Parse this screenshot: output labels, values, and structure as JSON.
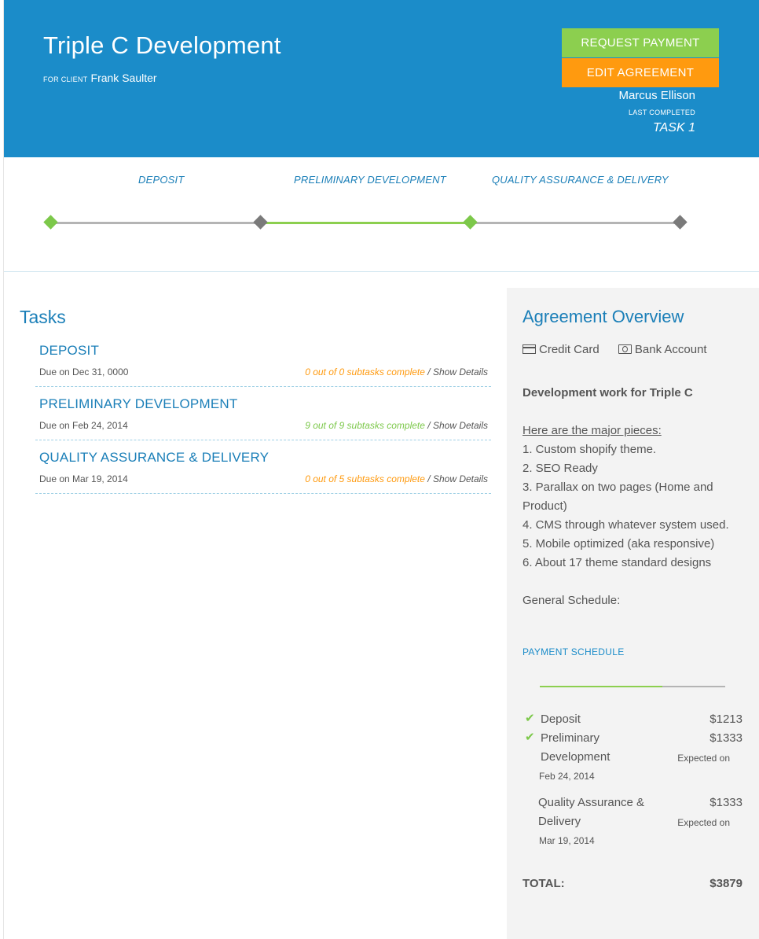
{
  "header": {
    "project_title": "Triple C Development",
    "client_label": "FOR CLIENT",
    "client_name": "Frank Saulter",
    "request_payment_label": "REQUEST PAYMENT",
    "edit_agreement_label": "EDIT AGREEMENT",
    "owner_name": "Marcus Ellison",
    "last_completed_label": "LAST COMPLETED",
    "last_completed_task": "TASK 1"
  },
  "progress": {
    "phases": [
      "DEPOSIT",
      "PRELIMINARY DEVELOPMENT",
      "QUALITY ASSURANCE & DELIVERY"
    ],
    "milestone_states": [
      "complete",
      "incomplete",
      "complete",
      "incomplete"
    ],
    "colors": {
      "complete": "#7cc84a",
      "incomplete": "#7a7a7a",
      "track_active": "#8ccf4f",
      "track_inactive": "#b4b4b4"
    }
  },
  "tasks": {
    "title": "Tasks",
    "items": [
      {
        "name": "DEPOSIT",
        "due": "Due on Dec 31, 0000",
        "subtasks": "0 out of 0 subtasks complete",
        "status_color": "orange",
        "separator": " / ",
        "details_label": "Show Details"
      },
      {
        "name": "PRELIMINARY DEVELOPMENT",
        "due": "Due on Feb 24, 2014",
        "subtasks": "9 out of 9 subtasks complete",
        "status_color": "green",
        "separator": " / ",
        "details_label": "Show Details"
      },
      {
        "name": "QUALITY ASSURANCE & DELIVERY",
        "due": "Due on Mar 19, 2014",
        "subtasks": "0 out of 5 subtasks complete",
        "status_color": "orange",
        "separator": " / ",
        "details_label": "Show Details"
      }
    ]
  },
  "overview": {
    "title": "Agreement Overview",
    "payment_methods": [
      {
        "label": "Credit Card",
        "icon": "credit-card-icon"
      },
      {
        "label": "Bank Account",
        "icon": "bank-account-icon"
      }
    ],
    "description": {
      "heading": "Development work for Triple C",
      "subheading": "Here are the major pieces:",
      "lines": [
        "1. Custom shopify theme.",
        "2. SEO Ready",
        "3. Parallax on two pages (Home and Product)",
        "4. CMS through whatever system used.",
        "5. Mobile optimized (aka responsive)",
        "6. About 17 theme standard designs"
      ],
      "trailing": "General Schedule:"
    },
    "payment_schedule": {
      "title": "PAYMENT SCHEDULE",
      "progress_fraction": 0.66,
      "items": [
        {
          "name": "Deposit",
          "amount": "$1213",
          "paid": true,
          "expected_label": "",
          "expected_date": ""
        },
        {
          "name": "Preliminary Development",
          "amount": "$1333",
          "paid": true,
          "expected_label": "Expected on",
          "expected_date": "Feb 24, 2014"
        },
        {
          "name": "Quality Assurance & Delivery",
          "amount": "$1333",
          "paid": false,
          "expected_label": "Expected on",
          "expected_date": "Mar 19, 2014"
        }
      ],
      "total_label": "TOTAL:",
      "total_value": "$3879"
    }
  }
}
